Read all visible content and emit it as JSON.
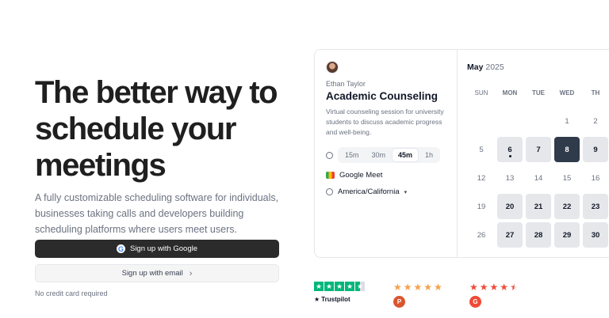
{
  "hero": {
    "headline_lines": [
      "The better way to",
      "schedule your",
      "meetings"
    ],
    "subtitle": "A fully customizable scheduling software for individuals, businesses taking calls and developers building scheduling platforms where users meet users.",
    "google_button": "Sign up with Google",
    "email_button": "Sign up with email",
    "no_credit": "No credit card required"
  },
  "booking": {
    "host": "Ethan Taylor",
    "title": "Academic Counseling",
    "description": "Virtual counseling session for university students to discuss academic progress and well-being.",
    "durations": [
      "15m",
      "30m",
      "45m",
      "1h"
    ],
    "selected_duration": "45m",
    "location": "Google Meet",
    "timezone": "America/California",
    "month": "May",
    "year": "2025",
    "weekdays": [
      "SUN",
      "MON",
      "TUE",
      "WED",
      "TH"
    ],
    "weeks": [
      [
        {
          "d": ""
        },
        {
          "d": ""
        },
        {
          "d": ""
        },
        {
          "d": "1"
        },
        {
          "d": "2"
        }
      ],
      [
        {
          "d": "5"
        },
        {
          "d": "6",
          "avail": true,
          "today": true
        },
        {
          "d": "7",
          "avail": true
        },
        {
          "d": "8",
          "avail": true,
          "selected": true
        },
        {
          "d": "9",
          "avail": true
        }
      ],
      [
        {
          "d": "12"
        },
        {
          "d": "13"
        },
        {
          "d": "14"
        },
        {
          "d": "15"
        },
        {
          "d": "16"
        }
      ],
      [
        {
          "d": "19"
        },
        {
          "d": "20",
          "avail": true
        },
        {
          "d": "21",
          "avail": true
        },
        {
          "d": "22",
          "avail": true
        },
        {
          "d": "23",
          "avail": true
        }
      ],
      [
        {
          "d": "26"
        },
        {
          "d": "27",
          "avail": true
        },
        {
          "d": "28",
          "avail": true
        },
        {
          "d": "29",
          "avail": true
        },
        {
          "d": "30",
          "avail": true
        }
      ]
    ]
  },
  "ratings": {
    "trustpilot_label": "Trustpilot",
    "producthunt_badge": "P",
    "g2_badge": "G",
    "colors": {
      "trustpilot": "#00b67a",
      "producthunt": "#da552f",
      "g2": "#ef4a36"
    }
  }
}
